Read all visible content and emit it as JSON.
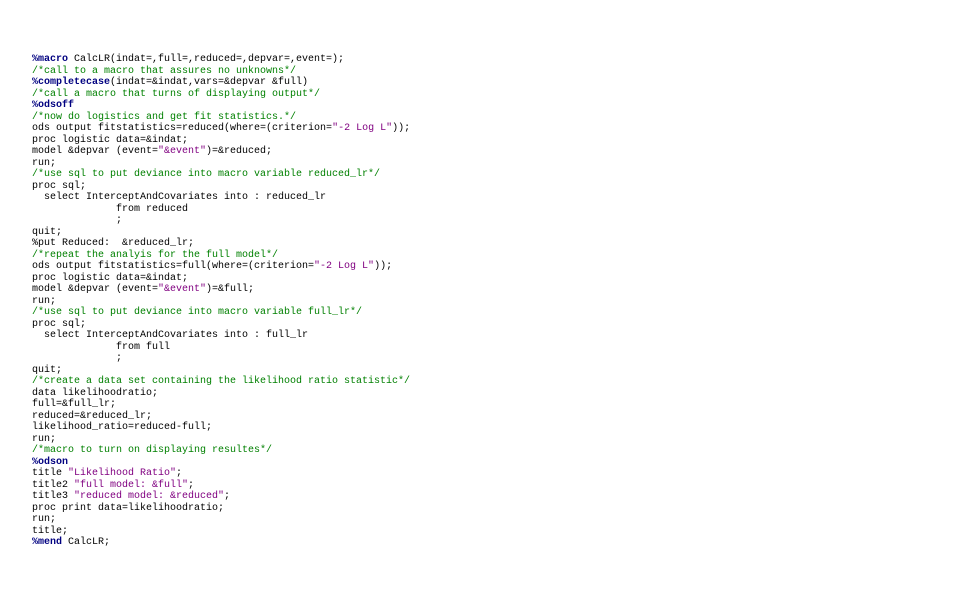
{
  "code": {
    "l1": {
      "kw": "%macro",
      "rest": " CalcLR(indat=,full=,reduced=,depvar=,event=);"
    },
    "l2": "/*call to a macro that assures no unknowns*/",
    "l3": {
      "mac": "%completecase",
      "rest": "(indat=&indat,vars=&depvar &full)"
    },
    "l4": "/*call a macro that turns of displaying output*/",
    "l5": "%odsoff",
    "l6": "/*now do logistics and get fit statistics.*/",
    "l7a": "ods output fitstatistics=reduced(where=(criterion=",
    "l7b": "\"-2 Log L\"",
    "l7c": "));",
    "l8": "proc logistic data=&indat;",
    "l9a": "model &depvar (event=",
    "l9b": "\"&event\"",
    "l9c": ")=&reduced;",
    "l10": "run;",
    "l11": "/*use sql to put deviance into macro variable reduced_lr*/",
    "l12": "proc sql;",
    "l13": "  select InterceptAndCovariates into : reduced_lr",
    "l14": "              from reduced",
    "l15": "              ;",
    "l16": "quit;",
    "l17": "%put Reduced:  &reduced_lr;",
    "l18": "/*repeat the analyis for the full model*/",
    "l19a": "ods output fitstatistics=full(where=(criterion=",
    "l19b": "\"-2 Log L\"",
    "l19c": "));",
    "l20": "proc logistic data=&indat;",
    "l21a": "model &depvar (event=",
    "l21b": "\"&event\"",
    "l21c": ")=&full;",
    "l22": "run;",
    "l23": "/*use sql to put deviance into macro variable full_lr*/",
    "l24": "proc sql;",
    "l25": "  select InterceptAndCovariates into : full_lr",
    "l26": "              from full",
    "l27": "              ;",
    "l28": "quit;",
    "l29": "/*create a data set containing the likelihood ratio statistic*/",
    "l30": "data likelihoodratio;",
    "l31": "full=&full_lr;",
    "l32": "reduced=&reduced_lr;",
    "l33": "likelihood_ratio=reduced-full;",
    "l34": "run;",
    "l35": "/*macro to turn on displaying resultes*/",
    "l36": "%odson",
    "l37a": "title ",
    "l37b": "\"Likelihood Ratio\"",
    "l37c": ";",
    "l38a": "title2 ",
    "l38b": "\"full model: &full\"",
    "l38c": ";",
    "l39a": "title3 ",
    "l39b": "\"reduced model: &reduced\"",
    "l39c": ";",
    "l40": "proc print data=likelihoodratio;",
    "l41": "run;",
    "l42": "title;",
    "l43": {
      "kw": "%mend",
      "rest": " CalcLR;"
    }
  }
}
